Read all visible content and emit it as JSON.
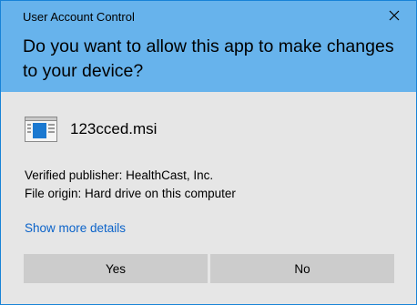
{
  "window": {
    "title": "User Account Control"
  },
  "header": {
    "question": "Do you want to allow this app to make changes to your device?"
  },
  "app": {
    "name": "123cced.msi",
    "icon": "installer-icon"
  },
  "details": {
    "publisher": "Verified publisher: HealthCast, Inc.",
    "origin": "File origin: Hard drive on this computer"
  },
  "links": {
    "show_more": "Show more details"
  },
  "buttons": {
    "yes": "Yes",
    "no": "No"
  },
  "colors": {
    "header": "#67b3ec",
    "body": "#e6e6e6",
    "button": "#cccccc",
    "link": "#0b63c9",
    "border": "#1883d7"
  }
}
